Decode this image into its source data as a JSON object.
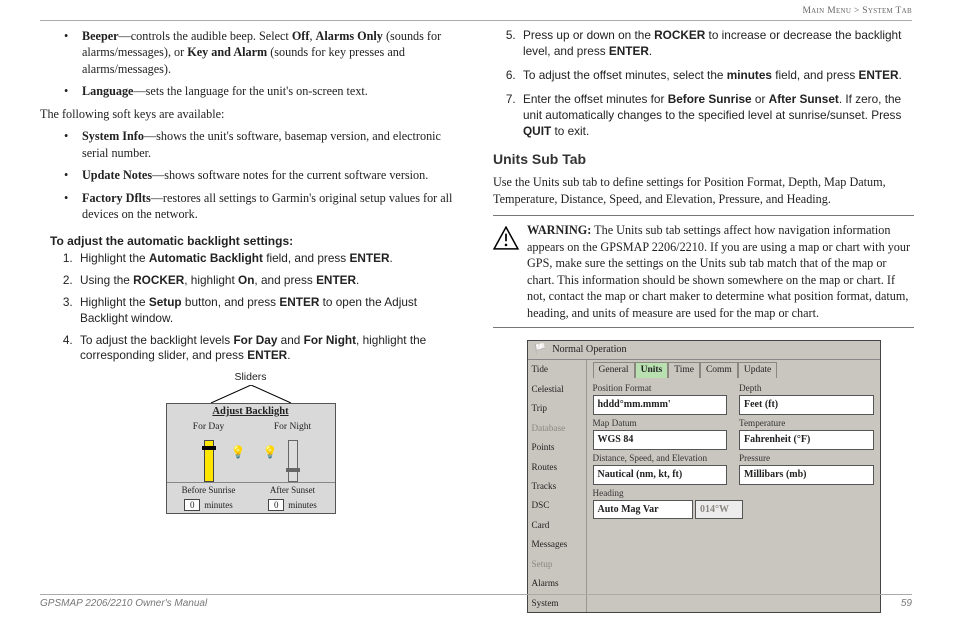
{
  "header": {
    "breadcrumb_left": "Main Menu",
    "breadcrumb_sep": " > ",
    "breadcrumb_right": "System Tab"
  },
  "left": {
    "bullets1": [
      {
        "term": "Beeper",
        "rest": "—controls the audible beep. Select ",
        "opts": [
          "Off",
          "Alarms Only",
          "Key and Alarm"
        ],
        "tail1": " (sounds for alarms/messages), or ",
        "tail2": " (sounds for key presses and alarms/messages)."
      },
      {
        "term": "Language",
        "rest": "—sets the language for the unit's on-screen text."
      }
    ],
    "soft_intro": "The following soft keys are available:",
    "bullets2": [
      {
        "term": "System Info",
        "rest": "—shows the unit's software, basemap version, and electronic serial number."
      },
      {
        "term": "Update Notes",
        "rest": "—shows software notes for the current software version."
      },
      {
        "term": "Factory Dflts",
        "rest": "—restores all settings to Garmin's original setup values for all devices on the network."
      }
    ],
    "adj_head": "To adjust the automatic backlight settings:",
    "steps": [
      {
        "pre": "Highlight the ",
        "b1": "Automatic Backlight",
        "mid": " field, and press ",
        "b2": "ENTER",
        "post": "."
      },
      {
        "pre": "Using the ",
        "b1": "ROCKER",
        "mid": ", highlight ",
        "b2": "On",
        "mid2": ", and press ",
        "b3": "ENTER",
        "post": "."
      },
      {
        "pre": "Highlight the ",
        "b1": "Setup",
        "mid": " button, and press ",
        "b2": "ENTER",
        "post": " to open the Adjust Backlight window."
      },
      {
        "pre": "To adjust the backlight levels ",
        "b1": "For Day",
        "mid": " and ",
        "b2": "For Night",
        "post": ", highlight the corresponding slider, and press ",
        "b3": "ENTER",
        "post2": "."
      }
    ],
    "fig_caption": "Sliders",
    "dlg": {
      "title": "Adjust Backlight",
      "for_day": "For Day",
      "for_night": "For Night",
      "before": "Before Sunrise",
      "after": "After Sunset",
      "min_val": "0",
      "min_lbl": "minutes"
    }
  },
  "right": {
    "steps": [
      {
        "n": 5,
        "pre": "Press up or down on the ",
        "b1": "ROCKER",
        "mid": " to increase or decrease the backlight level, and press ",
        "b2": "ENTER",
        "post": "."
      },
      {
        "n": 6,
        "pre": "To adjust the offset minutes, select the ",
        "b1": "minutes",
        "mid": " field, and press ",
        "b2": "ENTER",
        "post": "."
      },
      {
        "n": 7,
        "pre": "Enter the offset minutes for ",
        "b1": "Before Sunrise",
        "mid": " or ",
        "b2": "After Sunset",
        "post": ". If zero, the unit automatically changes to the specified level at sunrise/sunset. Press ",
        "b3": "QUIT",
        "post2": " to exit."
      }
    ],
    "sub_head": "Units Sub Tab",
    "sub_text": "Use the Units sub tab to define settings for Position Format, Depth, Map Datum, Temperature, Distance, Speed, and Elevation, Pressure, and Heading.",
    "warn_label": "WARNING:",
    "warn_text": " The Units sub tab settings affect how navigation information appears on the GPSMAP 2206/2210. If you are using a map or chart with your GPS, make sure the settings on the Units sub tab match that of the map or chart. This information should be shown somewhere on the map or chart. If not, contact the map or chart maker to determine what position format, datum, heading, and units of measure are used for the map or chart.",
    "uf": {
      "top": "Normal Operation",
      "side": [
        "Tide",
        "Celestial",
        "Trip",
        "Database",
        "Points",
        "Routes",
        "Tracks",
        "DSC",
        "Card",
        "Messages",
        "Setup",
        "Alarms",
        "System"
      ],
      "side_dim": [
        3,
        10
      ],
      "tabs": [
        "General",
        "Units",
        "Time",
        "Comm",
        "Update"
      ],
      "tab_sel": 1,
      "rows": {
        "posfmt_l": "Position Format",
        "posfmt_v": "hddd°mm.mmm'",
        "depth_l": "Depth",
        "depth_v": "Feet (ft)",
        "datum_l": "Map Datum",
        "datum_v": "WGS 84",
        "temp_l": "Temperature",
        "temp_v": "Fahrenheit (°F)",
        "dse_l": "Distance, Speed, and Elevation",
        "dse_v": "Nautical (nm, kt, ft)",
        "press_l": "Pressure",
        "press_v": "Millibars (mb)",
        "head_l": "Heading",
        "head_v": "Auto Mag Var",
        "head_dim": "014°W"
      }
    }
  },
  "footer": {
    "left": "GPSMAP 2206/2210 Owner's Manual",
    "right": "59"
  }
}
